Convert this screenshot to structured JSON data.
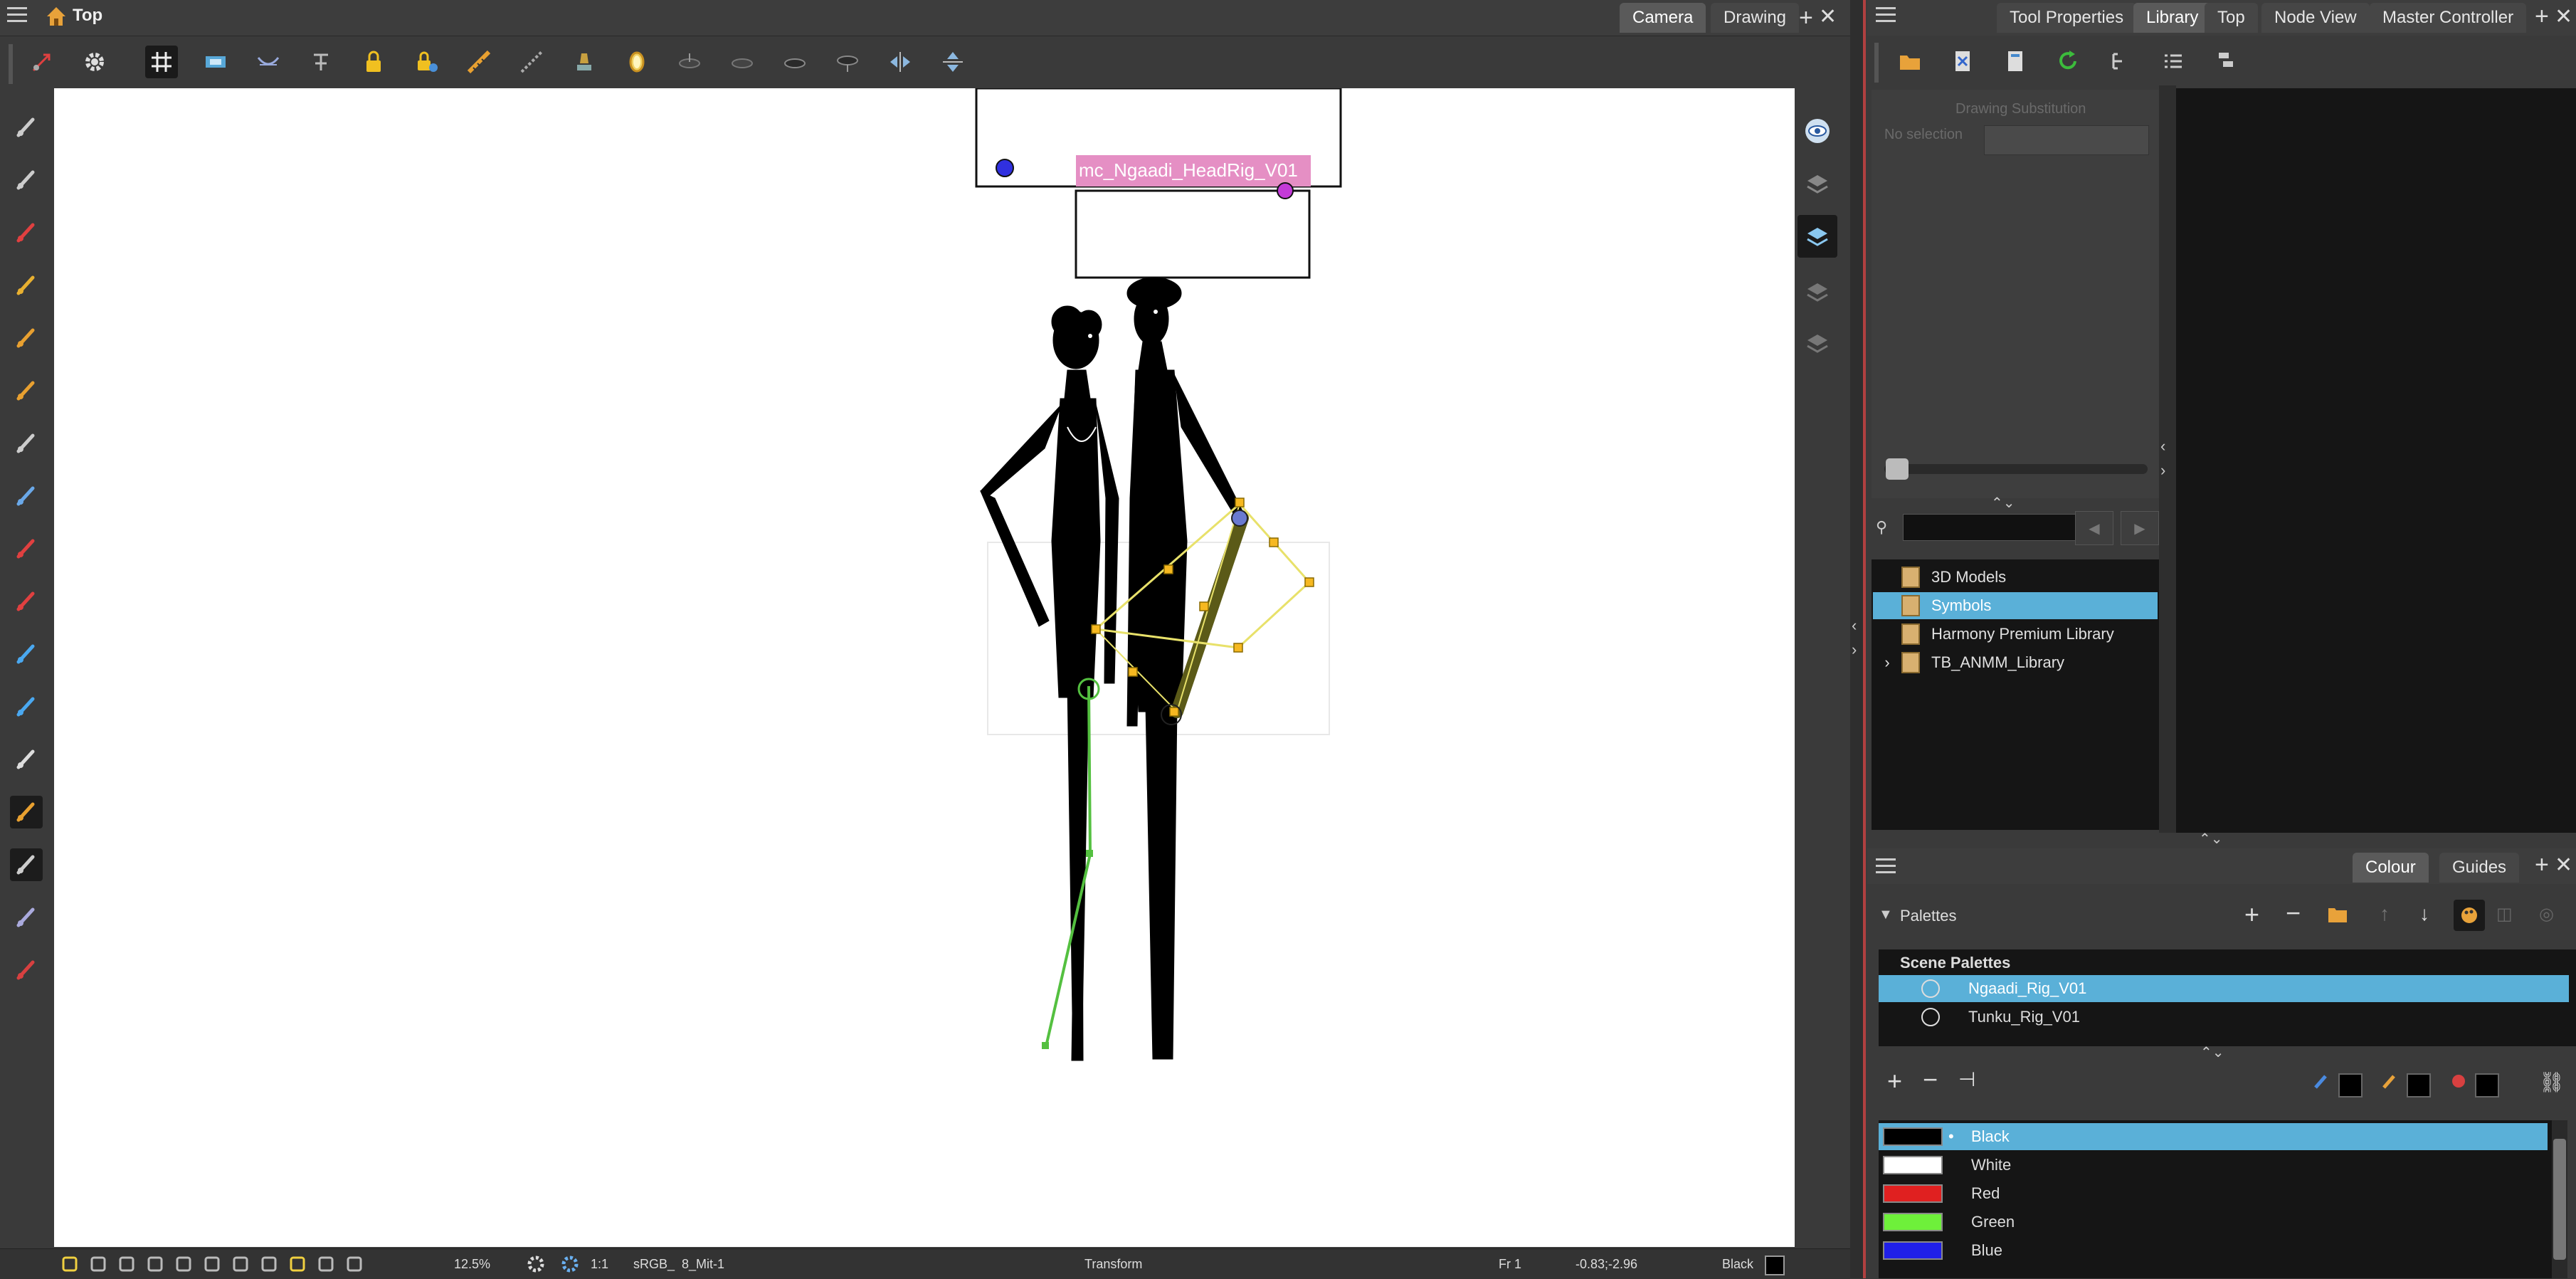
{
  "top_bar": {
    "view_title": "Top",
    "view_tabs": [
      {
        "label": "Camera",
        "active": true
      },
      {
        "label": "Drawing",
        "active": false
      }
    ]
  },
  "right_tabs": [
    {
      "label": "Tool Properties",
      "active": false
    },
    {
      "label": "Library",
      "active": true
    },
    {
      "label": "Top",
      "active": false
    },
    {
      "label": "Node View",
      "active": false
    },
    {
      "label": "Master Controller",
      "active": false
    }
  ],
  "canvas": {
    "node_label": "mc_Ngaadi_HeadRig_V01",
    "background": "#ffffff",
    "selection_color": "#e8e16a",
    "bone_color": "#5b5a18",
    "chain_color": "#54c040",
    "label_bg": "#e58fc4"
  },
  "drawing_substitution": {
    "title": "Drawing Substitution",
    "selection_text": "No selection"
  },
  "library": {
    "items": [
      {
        "label": "3D Models",
        "selected": false,
        "expandable": false
      },
      {
        "label": "Symbols",
        "selected": true,
        "expandable": false
      },
      {
        "label": "Harmony Premium Library",
        "selected": false,
        "expandable": false
      },
      {
        "label": "TB_ANMM_Library",
        "selected": false,
        "expandable": true
      }
    ]
  },
  "colour_panel": {
    "tabs": [
      {
        "label": "Colour",
        "active": true
      },
      {
        "label": "Guides",
        "active": false
      }
    ],
    "palettes_label": "Palettes",
    "scene_palettes_label": "Scene Palettes",
    "palettes": [
      {
        "name": "Ngaadi_Rig_V01",
        "selected": true
      },
      {
        "name": "Tunku_Rig_V01",
        "selected": false
      }
    ],
    "colours": [
      {
        "name": "Black",
        "hex": "#000000",
        "selected": true
      },
      {
        "name": "White",
        "hex": "#ffffff",
        "selected": false
      },
      {
        "name": "Red",
        "hex": "#e02020",
        "selected": false
      },
      {
        "name": "Green",
        "hex": "#6ef03a",
        "selected": false
      },
      {
        "name": "Blue",
        "hex": "#2020e8",
        "selected": false
      }
    ]
  },
  "status_bar": {
    "zoom": "12.5%",
    "ratio": "1:1",
    "colorspace": "sRGB_",
    "bit": "8_Mit-1",
    "tool": "Transform",
    "frame": "Fr 1",
    "coords": "-0.83;-2.96",
    "current_colour": "Black"
  },
  "icons": {
    "toolbar": [
      "reset-view-icon",
      "gear-icon",
      "grid-icon",
      "light-table-icon",
      "onion-skin-icon",
      "turnaround-icon",
      "lock-icon",
      "lock-all-icon",
      "ruler-icon",
      "perspective-icon",
      "stamp-icon",
      "mirror-icon",
      "layer-a-icon",
      "layer-b-icon",
      "layer-c-icon",
      "layer-d-icon",
      "flip-h-icon",
      "flip-v-icon"
    ],
    "tools": [
      "select-icon",
      "contour-editor-icon",
      "brush-icon",
      "pencil-icon",
      "stamp-icon",
      "eraser-icon",
      "text-icon",
      "rectangle-icon",
      "paint-icon",
      "dropper-icon",
      "pivot-icon",
      "hand-icon",
      "glove-icon",
      "rigging-icon",
      "transform-icon",
      "cutter-icon",
      "ink-pot-icon"
    ]
  }
}
